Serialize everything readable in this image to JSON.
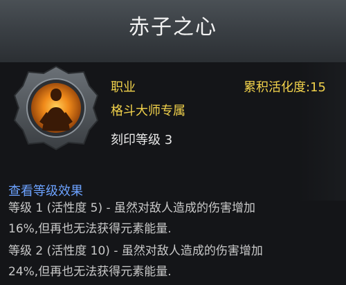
{
  "title": "赤子之心",
  "header": {
    "class_label": "职业",
    "affinity_label": "累积活化度:",
    "affinity_value": "15",
    "class_name": "格斗大师专属",
    "engrave_level": "刻印等级 3"
  },
  "icon": {
    "name": "fighter-silhouette-icon",
    "accent": "#f08a1a",
    "frame": "#5f656b"
  },
  "effects": {
    "link_label": "查看等级效果",
    "lines": [
      "等级 1 (活性度 5) - 虽然对敌人造成的伤害增加",
      "16%,但再也无法获得元素能量.",
      "等级 2 (活性度 10) - 虽然对敌人造成的伤害增加",
      "24%,但再也无法获得元素能量."
    ]
  }
}
